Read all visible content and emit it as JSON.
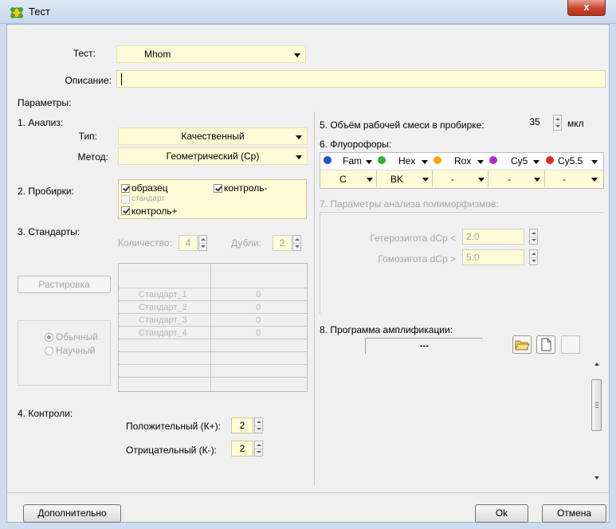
{
  "window": {
    "title": "Тест",
    "close_glyph": "x"
  },
  "test": {
    "label": "Тест:",
    "value": "Mhom"
  },
  "description": {
    "label": "Описание:",
    "value": ""
  },
  "params_label": "Параметры:",
  "analysis": {
    "label": "1. Анализ:",
    "type_label": "Тип:",
    "type_value": "Качественный",
    "method_label": "Метод:",
    "method_value": "Геометрический (Cp)"
  },
  "tubes": {
    "label": "2. Пробирки:",
    "sample": "образец",
    "control_minus": "контроль-",
    "standard": "стандарт",
    "control_plus": "контроль+"
  },
  "standards": {
    "label": "3. Стандарты:",
    "count_label": "Количество:",
    "count_value": "4",
    "dupl_label": "Дубли:",
    "dupl_value": "2",
    "titration_button": "Растировка",
    "rows": [
      {
        "name": "Стандарт_1",
        "value": "0"
      },
      {
        "name": "Стандарт_2",
        "value": "0"
      },
      {
        "name": "Стандарт_3",
        "value": "0"
      },
      {
        "name": "Стандарт_4",
        "value": "0"
      }
    ],
    "mode_normal": "Обычный",
    "mode_scientific": "Научный"
  },
  "controls": {
    "label": "4. Контроли:",
    "positive_label": "Положительный (К+):",
    "positive_value": "2",
    "negative_label": "Отрицательный (К-):",
    "negative_value": "2"
  },
  "volume": {
    "label": "5. Объём рабочей смеси в пробирке:",
    "value": "35",
    "unit": "мкл"
  },
  "fluorophores": {
    "label": "6. Флуорофоры:",
    "channels": [
      {
        "name": "Fam",
        "color": "#1f52d6",
        "sub": "C"
      },
      {
        "name": "Hex",
        "color": "#2fb52c",
        "sub": "BK"
      },
      {
        "name": "Rox",
        "color": "#f4a50f",
        "sub": "-"
      },
      {
        "name": "Cy5",
        "color": "#b22ad0",
        "sub": "-"
      },
      {
        "name": "Cy5.5",
        "color": "#e12b1e",
        "sub": "-"
      }
    ]
  },
  "polymorphism": {
    "label": "7. Параметры анализа полиморфизмов:",
    "hetero_label": "Гетерозигота dCp <",
    "hetero_value": "2.0",
    "homo_label": "Гомозигота dCp >",
    "homo_value": "5.0"
  },
  "program": {
    "label": "8. Программа амплификации:",
    "value": "---"
  },
  "footer": {
    "more_button": "Дополнительно",
    "ok_button": "Ok",
    "cancel_button": "Отмена"
  }
}
